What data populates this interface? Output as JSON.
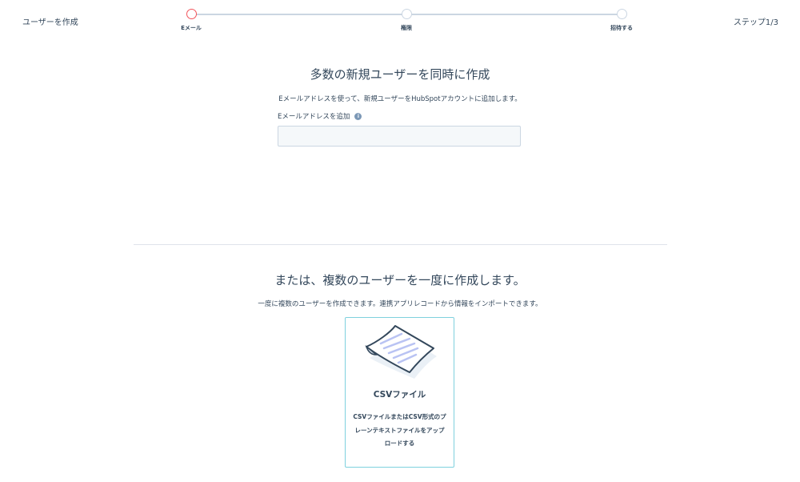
{
  "header": {
    "title": "ユーザーを作成",
    "step_count": "ステップ1/3",
    "steps": [
      {
        "label": "Eメール",
        "active": true
      },
      {
        "label": "権限",
        "active": false
      },
      {
        "label": "招待する",
        "active": false
      }
    ]
  },
  "section1": {
    "title": "多数の新規ユーザーを同時に作成",
    "description": "Eメールアドレスを使って、新規ユーザーをHubSpotアカウントに追加します。",
    "field_label": "Eメールアドレスを追加",
    "info_icon": "i",
    "input_value": ""
  },
  "section2": {
    "title": "または、複数のユーザーを一度に作成します。",
    "description": "一度に複数のユーザーを作成できます。連携アプリレコードから情報をインポートできます。"
  },
  "csv_card": {
    "title": "CSVファイル",
    "description": "CSVファイルまたはCSV形式のプレーンテキストファイルをアップロードする"
  },
  "colors": {
    "active_step": "#f2545b",
    "inactive_step": "#cbd6e2",
    "text": "#33475b",
    "card_border": "#7fd1de"
  }
}
